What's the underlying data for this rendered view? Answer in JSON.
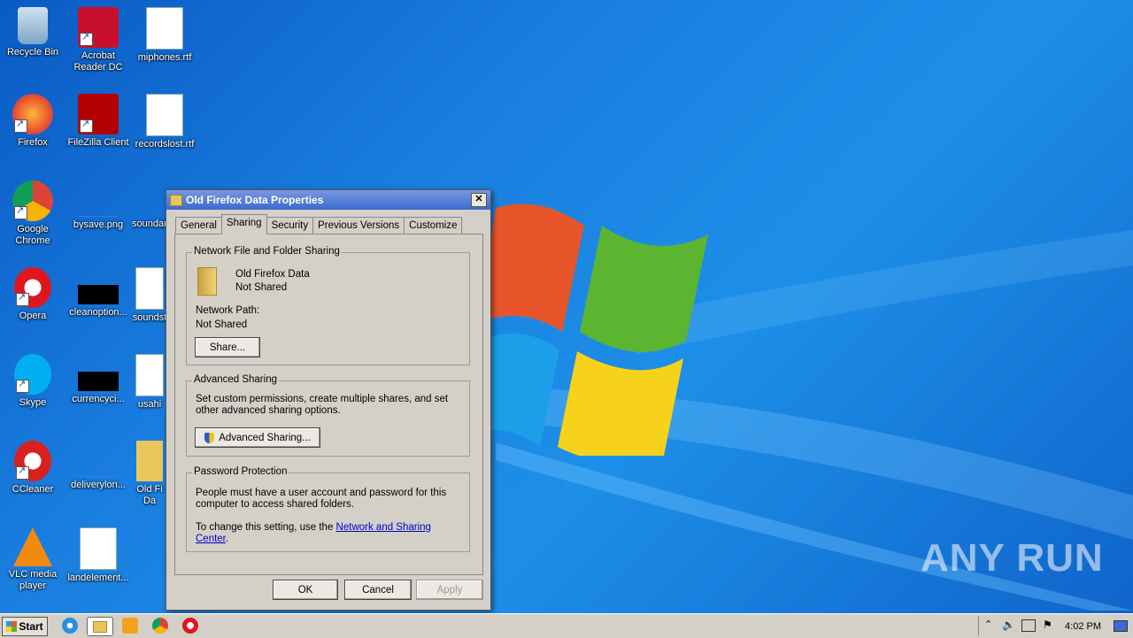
{
  "desktop": {
    "icons": [
      {
        "label": "Recycle Bin"
      },
      {
        "label": "Acrobat Reader DC"
      },
      {
        "label": "miphones.rtf"
      },
      {
        "label": "Firefox"
      },
      {
        "label": "FileZilla Client"
      },
      {
        "label": "recordslost.rtf"
      },
      {
        "label": "Google Chrome"
      },
      {
        "label": "bysave.png"
      },
      {
        "label": "soundarp"
      },
      {
        "label": "Opera"
      },
      {
        "label": "cleanoption..."
      },
      {
        "label": "soundst"
      },
      {
        "label": "Skype"
      },
      {
        "label": "currencyci..."
      },
      {
        "label": "usahi"
      },
      {
        "label": "CCleaner"
      },
      {
        "label": "deliverylon..."
      },
      {
        "label": "Old Fi Da"
      },
      {
        "label": "VLC media player"
      },
      {
        "label": "landelement..."
      }
    ],
    "watermark": "ANY RUN"
  },
  "dialog": {
    "title": "Old Firefox Data Properties",
    "close_label": "✕",
    "tabs": [
      "General",
      "Sharing",
      "Security",
      "Previous Versions",
      "Customize"
    ],
    "active_tab": "Sharing",
    "network_sharing": {
      "title": "Network File and Folder Sharing",
      "folder_name": "Old Firefox Data",
      "folder_status": "Not Shared",
      "path_label": "Network Path:",
      "path_value": "Not Shared",
      "share_button": "Share..."
    },
    "advanced_sharing": {
      "title": "Advanced Sharing",
      "description": "Set custom permissions, create multiple shares, and set other advanced sharing options.",
      "button": "Advanced Sharing..."
    },
    "password_protection": {
      "title": "Password Protection",
      "description": "People must have a user account and password for this computer to access shared folders.",
      "change_prefix": "To change this setting, use the ",
      "link": "Network and Sharing Center",
      "change_suffix": "."
    },
    "buttons": {
      "ok": "OK",
      "cancel": "Cancel",
      "apply": "Apply"
    }
  },
  "taskbar": {
    "start_label": "Start",
    "clock": "4:02 PM"
  }
}
